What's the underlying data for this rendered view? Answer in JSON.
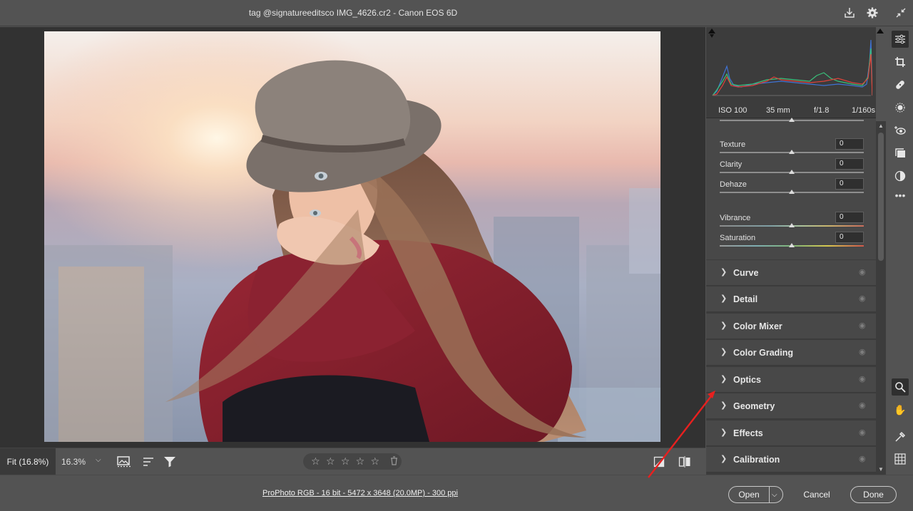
{
  "window": {
    "title": "tag @signatureeditsco IMG_4626.cr2  -  Canon EOS 6D"
  },
  "canvas": {
    "fit_label": "Fit (16.8%)",
    "zoom_value": "16.3%"
  },
  "rating": {
    "stars": [
      "☆",
      "☆",
      "☆",
      "☆",
      "☆"
    ],
    "trash_icon": "trash-icon"
  },
  "footer": {
    "info_link": "ProPhoto RGB - 16 bit - 5472 x 3648 (20.0MP) - 300 ppi",
    "open_label": "Open",
    "cancel_label": "Cancel",
    "done_label": "Done"
  },
  "exif": {
    "iso": "ISO 100",
    "focal": "35 mm",
    "aperture": "f/1.8",
    "shutter": "1/160s"
  },
  "presence": [
    {
      "label": "Texture",
      "value": "0"
    },
    {
      "label": "Clarity",
      "value": "0"
    },
    {
      "label": "Dehaze",
      "value": "0"
    },
    {
      "label": "Vibrance",
      "value": "0"
    },
    {
      "label": "Saturation",
      "value": "0"
    }
  ],
  "sections": [
    "Curve",
    "Detail",
    "Color Mixer",
    "Color Grading",
    "Optics",
    "Geometry",
    "Effects",
    "Calibration"
  ],
  "colors": {
    "panel_bg": "#484848",
    "arrow": "#e8201f",
    "histogram_red": "#e0413a",
    "histogram_green": "#39c17a",
    "histogram_blue": "#3e72d4"
  }
}
